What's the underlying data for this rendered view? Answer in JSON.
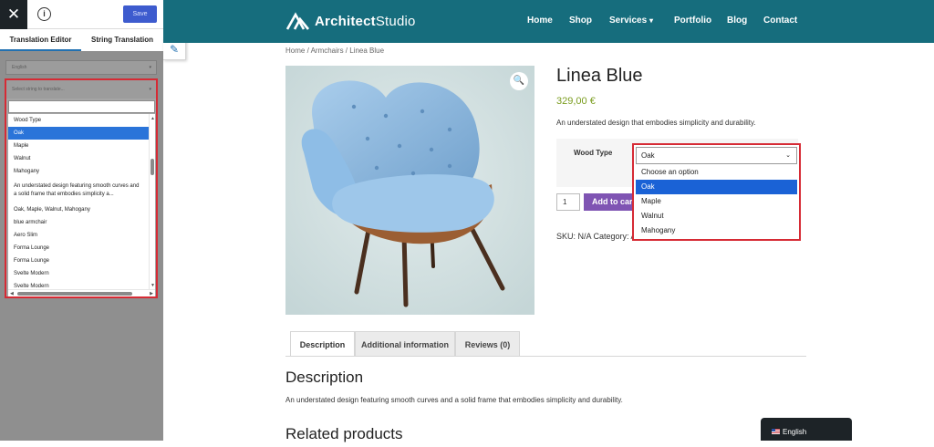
{
  "editor": {
    "close_glyph": "✕",
    "info_glyph": "i",
    "save_label": "Save",
    "tabs": [
      "Translation Editor",
      "String Translation"
    ],
    "language_select": {
      "value": "English",
      "caret": "▾"
    },
    "string_select": {
      "placeholder": "Select string to translate...",
      "caret": "▾",
      "search_value": "",
      "options": [
        {
          "label": "Wood Type",
          "selected": false
        },
        {
          "label": "Oak",
          "selected": true
        },
        {
          "label": "Maple",
          "selected": false
        },
        {
          "label": "Walnut",
          "selected": false
        },
        {
          "label": "Mahogany",
          "selected": false
        },
        {
          "label": "An understated design featuring smooth curves and a solid frame that embodies simplicity a...",
          "selected": false
        },
        {
          "label": "Oak, Maple, Walnut, Mahogany",
          "selected": false
        },
        {
          "label": "blue armchair",
          "selected": false
        },
        {
          "label": "Aero Slim",
          "selected": false
        },
        {
          "label": "Forma Lounge",
          "selected": false
        },
        {
          "label": "Forma Lounge",
          "selected": false
        },
        {
          "label": "Svelte Modern",
          "selected": false
        },
        {
          "label": "Svelte Modern",
          "selected": false
        }
      ],
      "scroll_up": "▲",
      "scroll_down": "▼",
      "scroll_left": "◀",
      "scroll_right": "▶"
    },
    "edit_glyph": "✎"
  },
  "site": {
    "logo_bold": "Architect",
    "logo_light": "Studio",
    "nav": [
      "Home",
      "Shop",
      "Services",
      "Portfolio",
      "Blog",
      "Contact"
    ],
    "nav_caret": "▾"
  },
  "product": {
    "breadcrumb": "Home / Armchairs / Linea Blue",
    "zoom_glyph": "🔍",
    "title": "Linea Blue",
    "price": "329,00 €",
    "short_description": "An understated design that embodies simplicity and durability.",
    "variation": {
      "label": "Wood Type",
      "value": "Oak",
      "caret": "⌄",
      "options": [
        {
          "label": "Choose an option",
          "selected": false
        },
        {
          "label": "Oak",
          "selected": true
        },
        {
          "label": "Maple",
          "selected": false
        },
        {
          "label": "Walnut",
          "selected": false
        },
        {
          "label": "Mahogany",
          "selected": false
        }
      ]
    },
    "quantity": "1",
    "add_to_cart": "Add to cart",
    "meta": "SKU: N/A Category: Armchairs",
    "tabs": [
      "Description",
      "Additional information",
      "Reviews (0)"
    ],
    "description_heading": "Description",
    "description_text": "An understated design featuring smooth curves and a solid frame that embodies simplicity and durability.",
    "related_heading": "Related products"
  },
  "language_switcher": {
    "label": "English"
  },
  "colors": {
    "header": "#166d7d",
    "price": "#7a9c1e",
    "button": "#7f54b3",
    "highlight_border": "#d62b35",
    "selection": "#1a62d6"
  }
}
